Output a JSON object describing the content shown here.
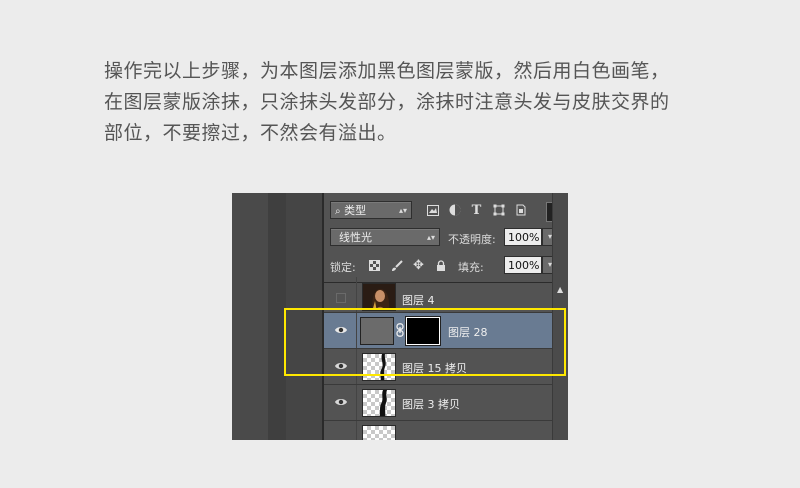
{
  "instructions": {
    "line1": "操作完以上步骤，为本图层添加黑色图层蒙版，然后用白色画笔，",
    "line2": "在图层蒙版涂抹，只涂抹头发部分，涂抹时注意头发与皮肤交界的",
    "line3": "部位，不要擦过，不然会有溢出。"
  },
  "layers_panel": {
    "filter_kind": "类型",
    "filter_icons": [
      "image-icon",
      "adjustment-icon",
      "type-icon",
      "shape-icon",
      "smart-object-icon"
    ],
    "blend_mode": "线性光",
    "opacity_label": "不透明度:",
    "opacity_value": "100%",
    "lock_label": "锁定:",
    "lock_icons": [
      "lock-transparent-icon",
      "lock-brush-icon",
      "lock-move-icon",
      "lock-all-icon"
    ],
    "fill_label": "填充:",
    "fill_value": "100%",
    "layers": [
      {
        "name": "图层 4",
        "visible": false,
        "selected": false
      },
      {
        "name": "图层 28",
        "visible": true,
        "selected": true,
        "has_mask": true
      },
      {
        "name": "图层 15 拷贝",
        "visible": true,
        "selected": false
      },
      {
        "name": "图层 3 拷贝",
        "visible": true,
        "selected": false
      }
    ]
  },
  "colors": {
    "selected_row": "#697b92",
    "highlight": "#ffe800",
    "panel_bg": "#535353"
  }
}
